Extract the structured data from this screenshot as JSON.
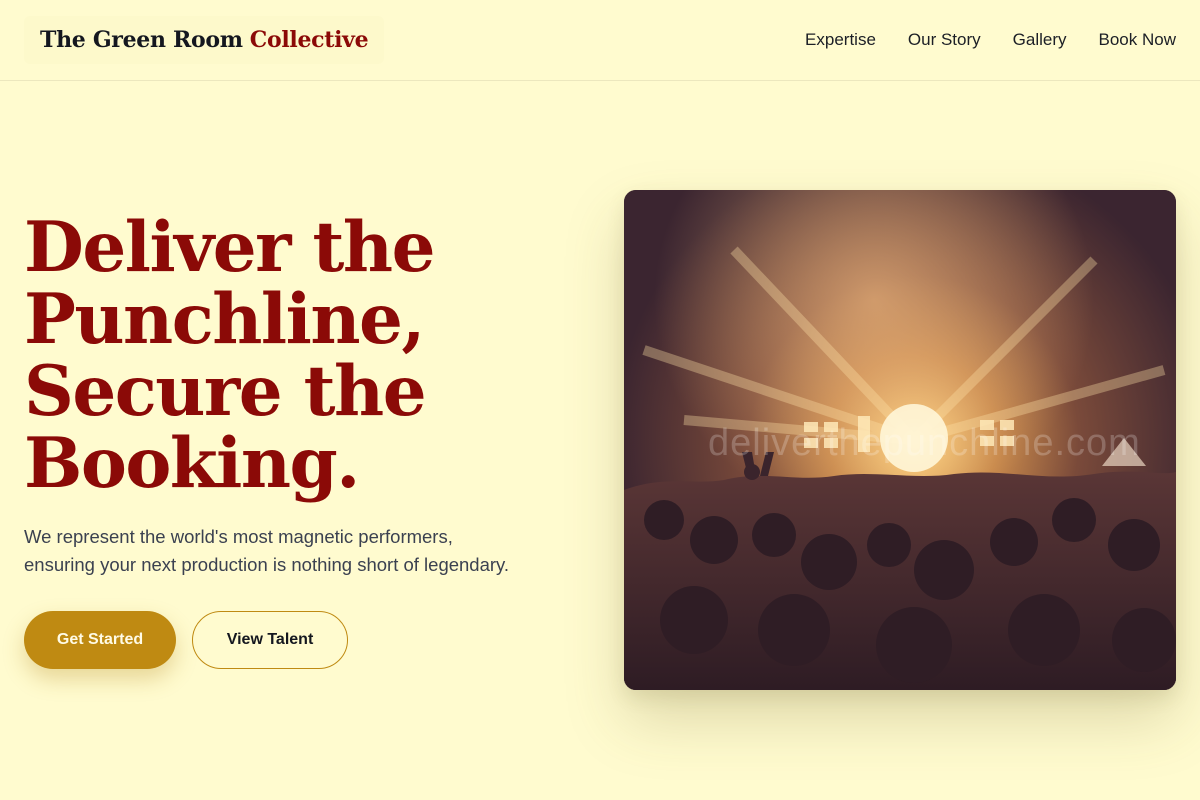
{
  "header": {
    "brand_main": "The Green Room",
    "brand_accent": "Collective",
    "nav": [
      {
        "label": "Expertise"
      },
      {
        "label": "Our Story"
      },
      {
        "label": "Gallery"
      },
      {
        "label": "Book Now"
      }
    ]
  },
  "hero": {
    "title_lines": [
      "Deliver the",
      "Punchline,",
      "Secure the",
      "Booking."
    ],
    "subtitle_lines": [
      "We represent the world's most magnetic performers,",
      "ensuring your next production is nothing short of legendary."
    ],
    "primary_cta": "Get Started",
    "secondary_cta": "View Talent",
    "image_watermark": "deliverthepunchline.com"
  },
  "colors": {
    "background": "#fffbcf",
    "accent_red": "#8b0a07",
    "gold": "#bf8a12",
    "text_dark": "#14171f"
  }
}
